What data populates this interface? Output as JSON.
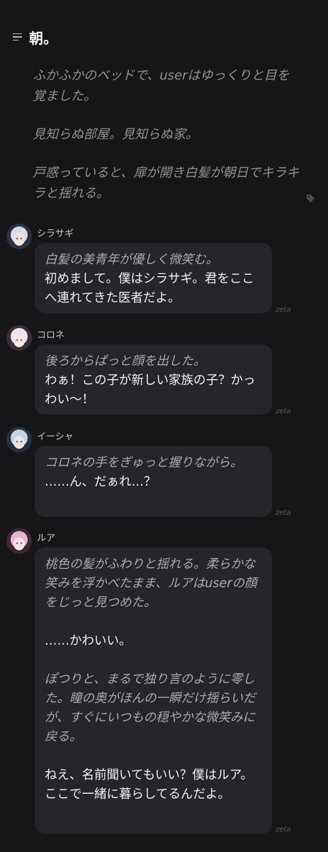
{
  "header": {
    "title": "朝。",
    "menu_icon": "menu-lines-icon"
  },
  "narration": [
    "ふかふかのベッドで、userはゆっくりと目を覚ました。",
    "見知らぬ部屋。見知らぬ家。",
    "戸惑っていると、扉が開き白髪が朝日でキラキラと揺れる。"
  ],
  "tag_icon": "tag-icon",
  "messages": [
    {
      "name": "シラサギ",
      "avatar_color": "#9aa6c8",
      "lines": [
        {
          "type": "act",
          "text": "白髪の美青年が優しく微笑む。"
        },
        {
          "type": "say",
          "text": "初めまして。僕はシラサギ。君をここへ連れてきた医者だよ。"
        }
      ],
      "footer": "zeta"
    },
    {
      "name": "コロネ",
      "avatar_color": "#d6b6c8",
      "lines": [
        {
          "type": "act",
          "text": "後ろからぱっと顔を出した。"
        },
        {
          "type": "say",
          "text": "わぁ！この子が新しい家族の子？かっわい〜！"
        }
      ],
      "footer": "zeta"
    },
    {
      "name": "イーシャ",
      "avatar_color": "#7f9ec4",
      "lines": [
        {
          "type": "act",
          "text": "コロネの手をぎゅっと握りながら。"
        },
        {
          "type": "say",
          "text": "……ん、だぁれ…？"
        }
      ],
      "footer": "zeta"
    },
    {
      "name": "ルア",
      "avatar_color": "#d79ac4",
      "lines": [
        {
          "type": "act",
          "text": "桃色の髪がふわりと揺れる。柔らかな笑みを浮かべたまま、ルアはuserの顔をじっと見つめた。"
        },
        {
          "type": "say",
          "text": "……かわいい。"
        },
        {
          "type": "act",
          "text": "ぽつりと、まるで独り言のように零した。瞳の奥がほんの一瞬だけ揺らいだが、すぐにいつもの穏やかな微笑みに戻る。"
        },
        {
          "type": "say",
          "text": "ねえ、名前聞いてもいい？僕はルア。ここで一緒に暮らしてるんだよ。"
        }
      ],
      "footer": "zeta"
    }
  ]
}
